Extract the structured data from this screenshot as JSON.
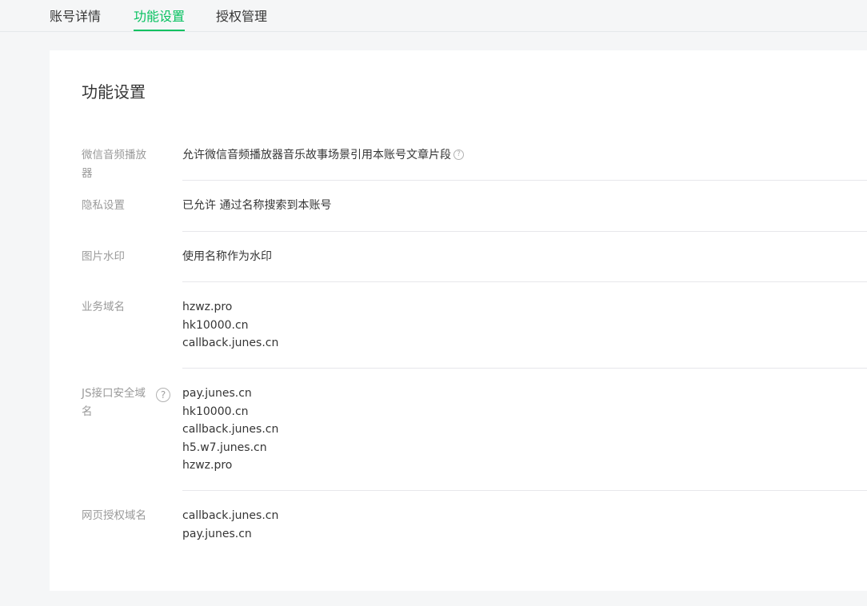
{
  "tabs": [
    {
      "label": "账号详情",
      "active": false
    },
    {
      "label": "功能设置",
      "active": true
    },
    {
      "label": "授权管理",
      "active": false
    }
  ],
  "panel": {
    "title": "功能设置"
  },
  "settings": {
    "audio_player": {
      "label": "微信音频播放器",
      "value": "允许微信音频播放器音乐故事场景引用本账号文章片段",
      "help_icon": "?"
    },
    "privacy": {
      "label": "隐私设置",
      "value": "已允许 通过名称搜索到本账号"
    },
    "watermark": {
      "label": "图片水印",
      "value": "使用名称作为水印"
    },
    "business_domain": {
      "label": "业务域名",
      "domains": [
        "hzwz.pro",
        "hk10000.cn",
        "callback.junes.cn"
      ]
    },
    "js_domain": {
      "label": "JS接口安全域名",
      "help_icon": "?",
      "domains": [
        "pay.junes.cn",
        "hk10000.cn",
        "callback.junes.cn",
        "h5.w7.junes.cn",
        "hzwz.pro"
      ]
    },
    "oauth_domain": {
      "label": "网页授权域名",
      "domains": [
        "callback.junes.cn",
        "pay.junes.cn"
      ]
    }
  },
  "colors": {
    "accent": "#07c160",
    "background": "#f5f6f7",
    "panel": "#ffffff",
    "label_text": "#9a9a9a",
    "body_text": "#353535",
    "divider": "#e7e7eb"
  }
}
